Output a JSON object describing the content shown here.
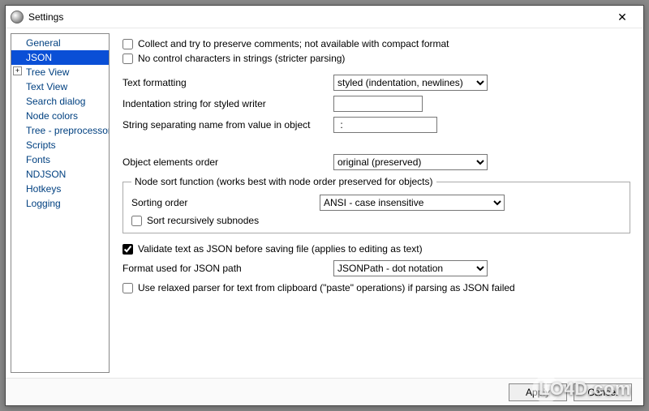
{
  "window": {
    "title": "Settings",
    "close_glyph": "✕"
  },
  "sidebar": {
    "items": [
      {
        "label": "General",
        "selected": false,
        "expander": null
      },
      {
        "label": "JSON",
        "selected": true,
        "expander": null
      },
      {
        "label": "Tree View",
        "selected": false,
        "expander": "+"
      },
      {
        "label": "Text View",
        "selected": false,
        "expander": null
      },
      {
        "label": "Search dialog",
        "selected": false,
        "expander": null
      },
      {
        "label": "Node colors",
        "selected": false,
        "expander": null
      },
      {
        "label": "Tree - preprocessor",
        "selected": false,
        "expander": null
      },
      {
        "label": "Scripts",
        "selected": false,
        "expander": null
      },
      {
        "label": "Fonts",
        "selected": false,
        "expander": null
      },
      {
        "label": "NDJSON",
        "selected": false,
        "expander": null
      },
      {
        "label": "Hotkeys",
        "selected": false,
        "expander": null
      },
      {
        "label": "Logging",
        "selected": false,
        "expander": null
      }
    ]
  },
  "form": {
    "preserve_comments": {
      "label": "Collect and try to preserve comments; not available with compact format",
      "checked": false
    },
    "no_control_chars": {
      "label": "No control characters in strings (stricter parsing)",
      "checked": false
    },
    "text_formatting": {
      "label": "Text formatting",
      "value": "styled (indentation, newlines)"
    },
    "indent_string": {
      "label": "Indentation string for styled writer",
      "value": ""
    },
    "name_value_sep": {
      "label": "String separating name from value in object",
      "value": " : "
    },
    "elements_order": {
      "label": "Object elements order",
      "value": "original (preserved)"
    },
    "sort_group_legend": "Node sort function (works best with node order preserved for objects)",
    "sorting_order": {
      "label": "Sorting order",
      "value": "ANSI - case insensitive"
    },
    "sort_recursive": {
      "label": "Sort recursively subnodes",
      "checked": false
    },
    "validate_before_save": {
      "label": "Validate text as JSON before saving file (applies to editing as text)",
      "checked": true
    },
    "json_path_format": {
      "label": "Format used for JSON path",
      "value": "JSONPath - dot notation"
    },
    "relaxed_parser": {
      "label": "Use relaxed parser for text from clipboard (\"paste\" operations) if parsing as JSON failed",
      "checked": false
    }
  },
  "footer": {
    "apply": "Apply",
    "cancel": "Cancel"
  },
  "watermark": "LO4D.com"
}
